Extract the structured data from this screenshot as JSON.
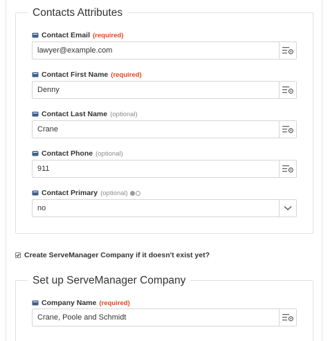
{
  "contacts_section": {
    "title": "Contacts Attributes",
    "fields": [
      {
        "label": "Contact Email",
        "tag": "(required)",
        "tag_kind": "required",
        "value": "lawyer@example.com",
        "button_icon": "list-settings-icon"
      },
      {
        "label": "Contact First Name",
        "tag": "(required)",
        "tag_kind": "required",
        "value": "Denny",
        "button_icon": "list-settings-icon"
      },
      {
        "label": "Contact Last Name",
        "tag": "(optional)",
        "tag_kind": "optional",
        "value": "Crane",
        "button_icon": "list-settings-icon"
      },
      {
        "label": "Contact Phone",
        "tag": "(optional)",
        "tag_kind": "optional",
        "value": "911",
        "button_icon": "list-settings-icon"
      },
      {
        "label": "Contact Primary",
        "tag": "(optional)",
        "tag_kind": "optional",
        "value": "no",
        "button_icon": "chevron-down-icon"
      }
    ]
  },
  "create_company_checkbox": {
    "label": "Create ServeManager Company if it doesn't exist yet?",
    "checked": true
  },
  "company_section": {
    "title": "Set up ServeManager Company",
    "fields": [
      {
        "label": "Company Name",
        "tag": "(required)",
        "tag_kind": "required",
        "value": "Crane, Poole and Schmidt",
        "button_icon": "list-settings-icon"
      }
    ]
  },
  "colors": {
    "required": "#e0461f",
    "optional": "#8a8a8a",
    "field_icon": "#3d5f8c",
    "border": "#d6d6d6"
  }
}
